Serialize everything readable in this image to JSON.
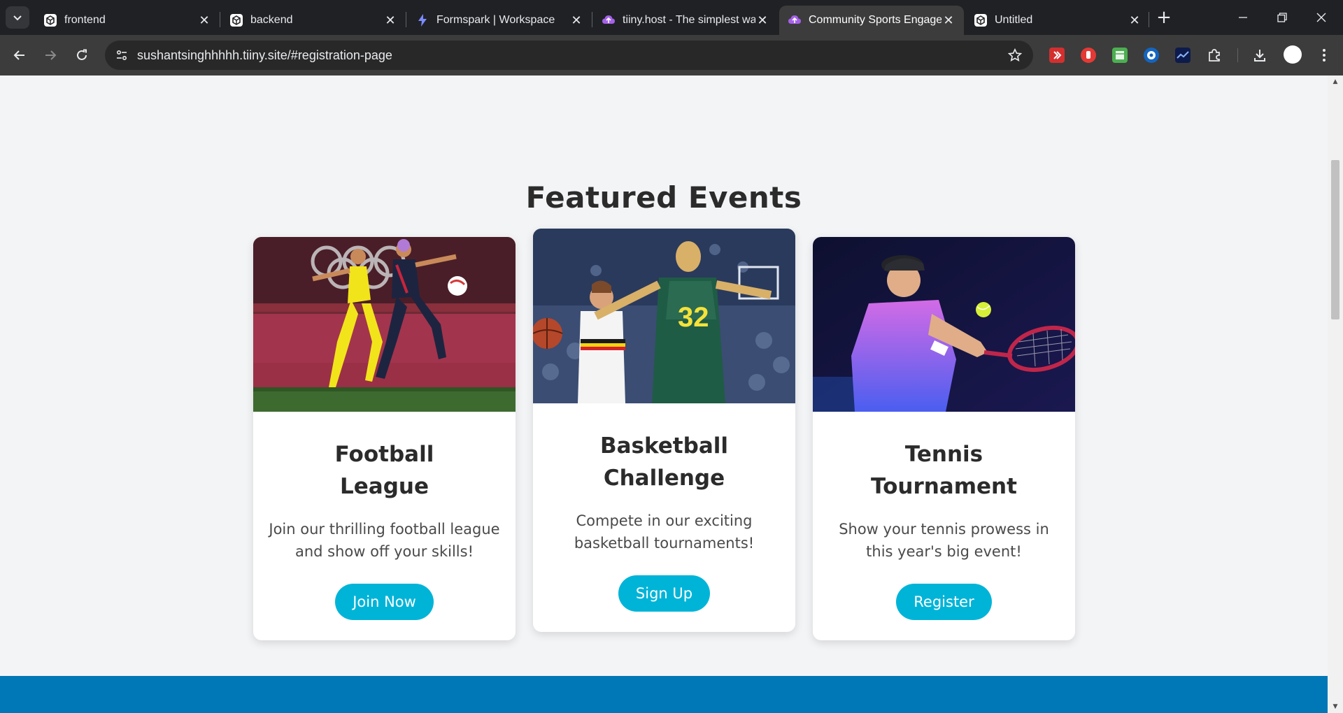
{
  "browser": {
    "tabs": [
      {
        "title": "frontend",
        "favicon": "codesandbox-icon",
        "active": false
      },
      {
        "title": "backend",
        "favicon": "codesandbox-icon",
        "active": false
      },
      {
        "title": "Formspark | Workspace",
        "favicon": "bolt-icon",
        "active": false
      },
      {
        "title": "tiiny.host - The simplest wa",
        "favicon": "cloud-icon",
        "active": false
      },
      {
        "title": "Community Sports Engage",
        "favicon": "cloud-icon",
        "active": true
      },
      {
        "title": "Untitled",
        "favicon": "codesandbox-icon",
        "active": false
      }
    ],
    "url": "sushantsinghhhhh.tiiny.site/#registration-page",
    "colors": {
      "tabbar": "#202124",
      "toolbar": "#3c3c3c",
      "active_tab": "#3c3c3c"
    }
  },
  "page": {
    "section_title": "Featured Events",
    "colors": {
      "background": "#f3f4f6",
      "accent": "#00b4d8",
      "footer": "#0077b6",
      "heading": "#2b2b2b"
    },
    "events": [
      {
        "title": "Football League",
        "description": "Join our thrilling football league and show off your skills!",
        "button": "Join Now",
        "image": "football-players-photo"
      },
      {
        "title": "Basketball Challenge",
        "description": "Compete in our exciting basketball tournaments!",
        "button": "Sign Up",
        "image": "basketball-players-photo"
      },
      {
        "title": "Tennis Tournament",
        "description": "Show your tennis prowess in this year's big event!",
        "button": "Register",
        "image": "tennis-player-photo"
      }
    ]
  }
}
